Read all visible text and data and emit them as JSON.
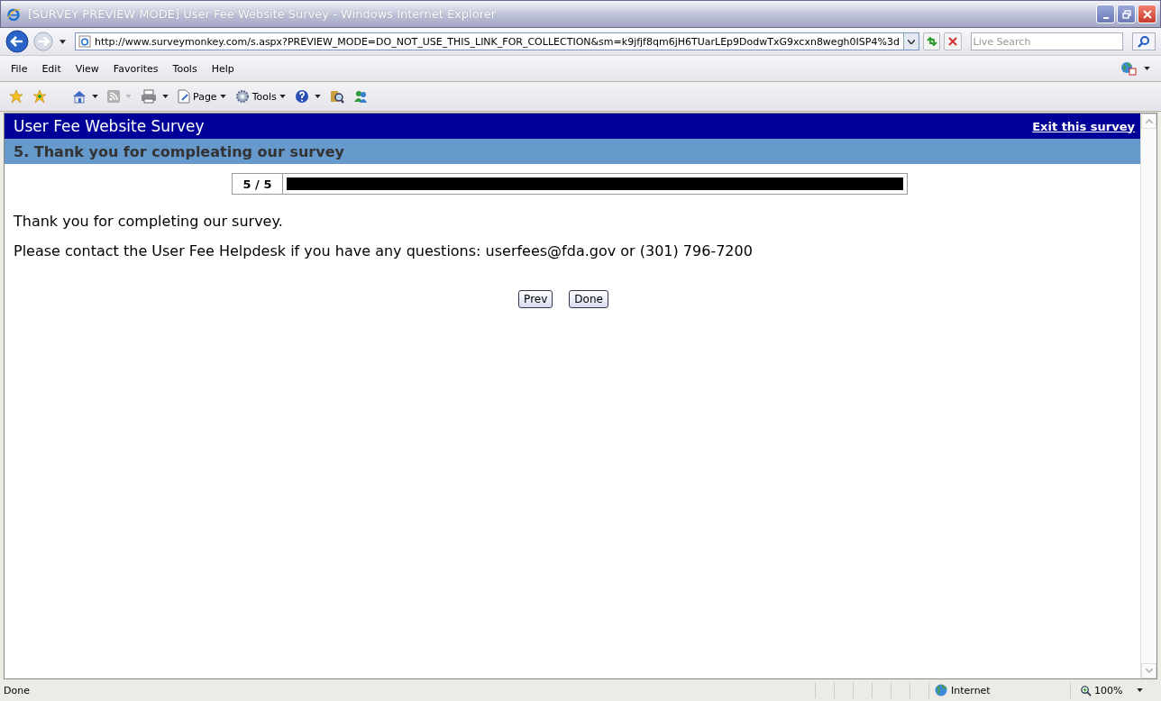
{
  "window": {
    "title": "[SURVEY PREVIEW MODE] User Fee Website Survey - Windows Internet Explorer"
  },
  "address_bar": {
    "url": "http://www.surveymonkey.com/s.aspx?PREVIEW_MODE=DO_NOT_USE_THIS_LINK_FOR_COLLECTION&sm=k9jfjf8qm6jH6TUarLEp9DodwTxG9xcxn8wegh0ISP4%3d"
  },
  "search": {
    "placeholder": "Live Search"
  },
  "menu": [
    "File",
    "Edit",
    "View",
    "Favorites",
    "Tools",
    "Help"
  ],
  "toolbar": {
    "page_label": "Page",
    "tools_label": "Tools"
  },
  "survey": {
    "title": "User Fee Website Survey",
    "exit_link": "Exit this survey",
    "section": "5. Thank you for compleating our survey",
    "progress": {
      "label": "5 / 5",
      "level": 1
    },
    "paragraphs": [
      "Thank you for completing our survey.",
      "Please contact the User Fee Helpdesk if you have any questions: userfees@fda.gov or (301) 796-7200"
    ],
    "buttons": [
      "Prev",
      "Done"
    ]
  },
  "status_bar": {
    "status": "Done",
    "zone": "Internet",
    "zoom": "100%"
  }
}
